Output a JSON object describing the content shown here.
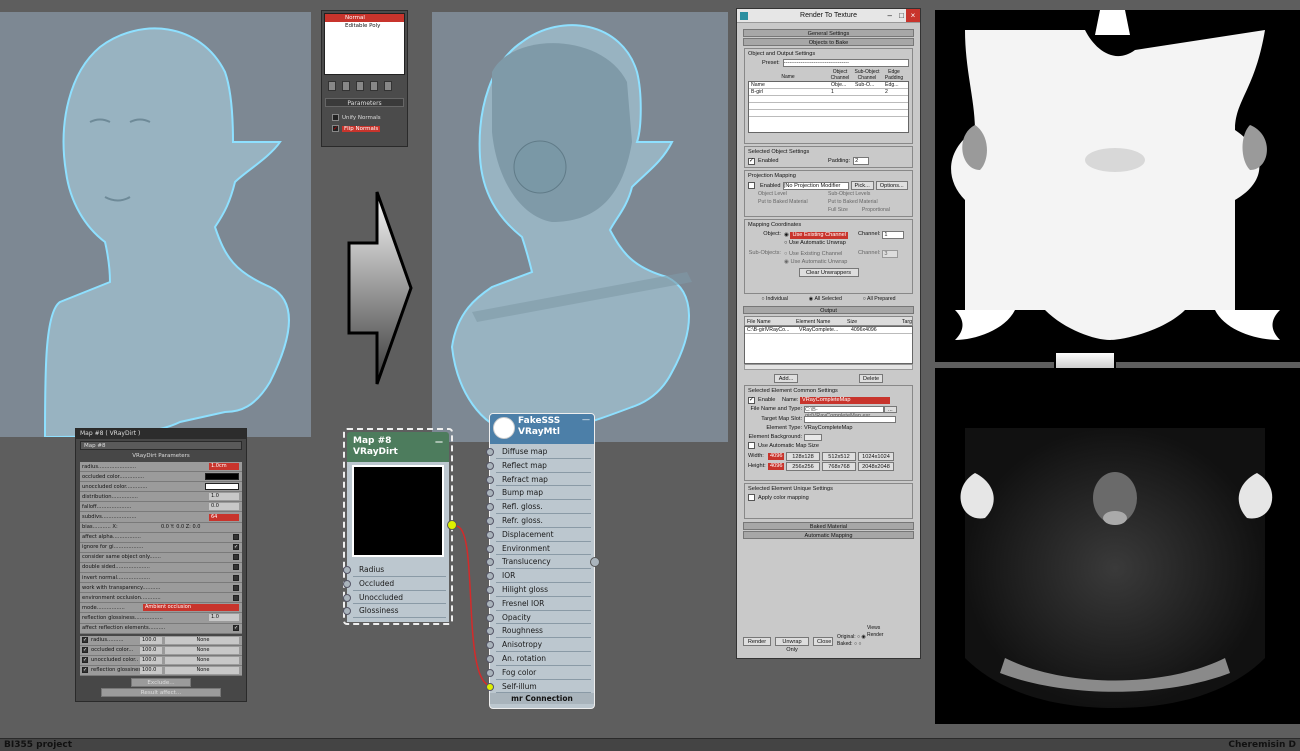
{
  "modifier_panel": {
    "stack": [
      "Normal",
      "Editable Poly"
    ],
    "params_title": "Parameters",
    "unify": "Unify Normals",
    "flip": "Flip Normals"
  },
  "vraydirt_panel": {
    "title": "Map #8  ( VRayDirt )",
    "map_field": "Map #8",
    "rollout": "VRayDirt Parameters",
    "params": [
      {
        "label": "radius.......................",
        "value": "1.0cm",
        "red": true
      },
      {
        "label": "occluded color...............",
        "value": "",
        "swatch": "#000000"
      },
      {
        "label": "unoccluded color.............",
        "value": "",
        "swatch": "#ffffff"
      },
      {
        "label": "distribution................",
        "value": "1.0"
      },
      {
        "label": "falloff.....................",
        "value": "0.0"
      },
      {
        "label": "subdivs.....................",
        "value": "64",
        "red": true
      },
      {
        "label": "bias........... X:",
        "value": "0.0  Y: 0.0  Z: 0.0"
      },
      {
        "label": "affect alpha.................",
        "check": false
      },
      {
        "label": "ignore for gi..................",
        "check": true
      },
      {
        "label": "consider same object only.......",
        "check": false
      },
      {
        "label": "double sided.....................",
        "check": false
      },
      {
        "label": "invert normal....................",
        "check": false
      },
      {
        "label": "work with transparency...........",
        "check": false
      },
      {
        "label": "environment occlusion............",
        "check": false
      },
      {
        "label": "mode.................",
        "value": "Ambient occlusion",
        "red": true,
        "wide": true
      },
      {
        "label": "reflection glossiness.................",
        "value": "1.0"
      },
      {
        "label": "affect reflection elements..........",
        "check": true
      }
    ],
    "maps": [
      {
        "label": "radius..........",
        "amt": "100.0",
        "map": "None"
      },
      {
        "label": "occluded color...",
        "amt": "100.0",
        "map": "None"
      },
      {
        "label": "unoccluded color..",
        "amt": "100.0",
        "map": "None"
      },
      {
        "label": "reflection glossines",
        "amt": "100.0",
        "map": "None"
      }
    ],
    "exclude": "Exclude...",
    "result": "Result affect..."
  },
  "dirt_node": {
    "line1": "Map #8",
    "line2": "VRayDirt",
    "slots": [
      "Radius",
      "Occluded",
      "Unoccluded",
      "Glossiness"
    ]
  },
  "mtl_node": {
    "line1": "FakeSSS",
    "line2": "VRayMtl",
    "slots": [
      "Diffuse map",
      "Reflect map",
      "Refract map",
      "Bump map",
      "Refl. gloss.",
      "Refr. gloss.",
      "Displacement",
      "Environment",
      "Translucency",
      "IOR",
      "Hilight gloss",
      "Fresnel IOR",
      "Opacity",
      "Roughness",
      "Anisotropy",
      "An. rotation",
      "Fog color",
      "Self-illum"
    ],
    "footer": "mr Connection"
  },
  "rtt": {
    "title": "Render To Texture",
    "general": "General Settings",
    "objects_to_bake": "Objects to Bake",
    "oos": "Object and Output Settings",
    "preset": "Preset:",
    "preset_value": "-----------------------------------",
    "th_name": "Name",
    "th_obj": "Object Channel",
    "th_sub": "Sub-Object Channel",
    "th_edge": "Edge Padding",
    "rows": [
      [
        "Name",
        "Obje...",
        "Sub-O...",
        "Edg..."
      ],
      [
        "B-girl",
        "1",
        "",
        "2"
      ]
    ],
    "sel_obj": "Selected Object Settings",
    "enabled": "Enabled",
    "padding": "Padding:",
    "padding_val": "2",
    "proj": "Projection Mapping",
    "proj_value": "(No Projection Modifier",
    "pick": "Pick...",
    "options": "Options...",
    "obj_level": "Object Level",
    "sub_levels": "Sub-Object Levels",
    "put_baked": "Put to Baked Material",
    "put_baked2": "Put to Baked Material",
    "full_size": "Full Size",
    "proportional": "Proportional",
    "mapcoords": "Mapping Coordinates",
    "object": "Object:",
    "use_existing": "Use Existing Channel",
    "use_auto": "Use Automatic Unwrap",
    "channel": "Channel:",
    "channel_val": "1",
    "subobjects": "Sub-Objects:",
    "use_existing2": "Use Existing Channel",
    "use_auto2": "Use Automatic Unwrap",
    "channel2": "Channel:",
    "channel2_val": "3",
    "clear": "Clear Unwrappers",
    "individual": "Individual",
    "all_selected": "All Selected",
    "all_prepared": "All Prepared",
    "output": "Output",
    "oh_file": "File Name",
    "oh_elem": "Element Name",
    "oh_size": "Size",
    "oh_targ": "Targ",
    "out_row": [
      "C:\\B-girlVRayCo...",
      "VRayComplete...",
      "4096x4096"
    ],
    "add": "Add...",
    "delete": "Delete",
    "sel_elem": "Selected Element Common Settings",
    "enable": "Enable",
    "name": "Name:",
    "name_val": "VRayCompleteMap",
    "file_type": "File Name and Type:",
    "file_val": "C:\\B-girlVRayCompleteMap.exr",
    "target_slot": "Target Map Slot:",
    "elem_type": "Element Type:",
    "elem_type_val": "VRayCompleteMap",
    "elem_bg": "Element Background:",
    "use_auto_size": "Use Automatic Map Size",
    "width": "Width:",
    "height": "Height:",
    "w_val": "4096",
    "h_val": "4096",
    "sizes": [
      "128x128",
      "512x512",
      "1024x1024",
      "256x256",
      "768x768",
      "2048x2048"
    ],
    "sel_elem_unique": "Selected Element Unique Settings",
    "apply_color": "Apply color mapping",
    "baked": "Baked Material",
    "auto_map": "Automatic Mapping",
    "render": "Render",
    "unwrap_only": "Unwrap Only",
    "close": "Close",
    "original": "Original:",
    "baked_lbl": "Baked:",
    "views": "Views",
    "render_lbl": "Render"
  },
  "footer": {
    "left": "BI355 project",
    "right": "Cheremisin D"
  }
}
